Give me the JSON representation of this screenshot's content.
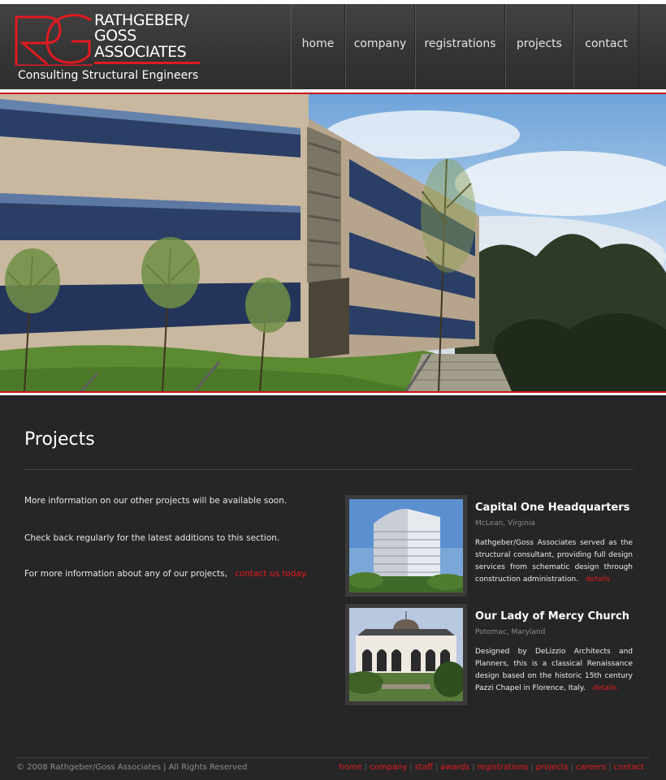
{
  "logo": {
    "line1": "RATHGEBER/",
    "line2": "GOSS",
    "line3": "ASSOCIATES",
    "tagline": "Consulting Structural Engineers"
  },
  "nav": [
    "home",
    "company",
    "registrations",
    "projects",
    "contact"
  ],
  "page": {
    "title": "Projects",
    "intro_1": "More information on our other projects will be available soon.",
    "intro_2": "Check back regularly for the latest additions to this section.",
    "intro_3": "For more information about any of our projects,",
    "contact_link": "contact us today."
  },
  "projects": [
    {
      "name": "Capital One Headquarters",
      "location": "McLean, Virginia",
      "description": "Rathgeber/Goss Associates served as the structural consultant, providing full design services from schematic design through construction administration.",
      "details": "details"
    },
    {
      "name": "Our Lady of Mercy Church",
      "location": "Potomac, Maryland",
      "description": "Designed by DeLizzio Architects and Planners, this is a classical Renaissance design based on the historic 15th century Pazzi Chapel in Florence, Italy.",
      "details": "details"
    }
  ],
  "footer": {
    "copyright": "© 2008 Rathgeber/Goss Associates | All Rights Reserved",
    "links": [
      "home",
      "company",
      "staff",
      "awards",
      "registrations",
      "projects",
      "careers",
      "contact"
    ]
  },
  "colors": {
    "accent_red": "#e5191f",
    "header_bg": "#393939",
    "content_bg": "#262626"
  }
}
